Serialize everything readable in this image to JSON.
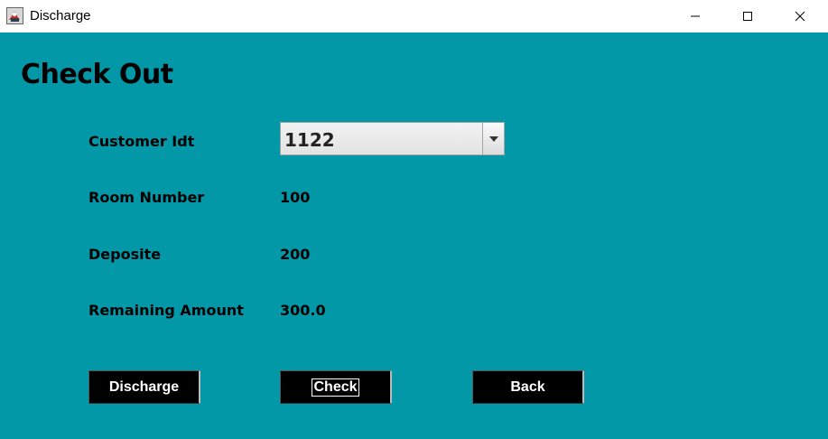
{
  "window": {
    "title": "Discharge",
    "icon": "java-app-icon"
  },
  "form": {
    "heading": "Check Out",
    "customer_id_label": "Customer Idt",
    "customer_id_value": "1122",
    "room_number_label": "Room Number",
    "room_number_value": "100",
    "deposit_label": "Deposite",
    "deposit_value": "200",
    "remaining_label": "Remaining Amount",
    "remaining_value": "300.0"
  },
  "buttons": {
    "discharge": "Discharge",
    "check": "Check",
    "back": "Back"
  },
  "colors": {
    "background": "#0398a8",
    "button": "#000000",
    "button_text": "#ffffff"
  }
}
